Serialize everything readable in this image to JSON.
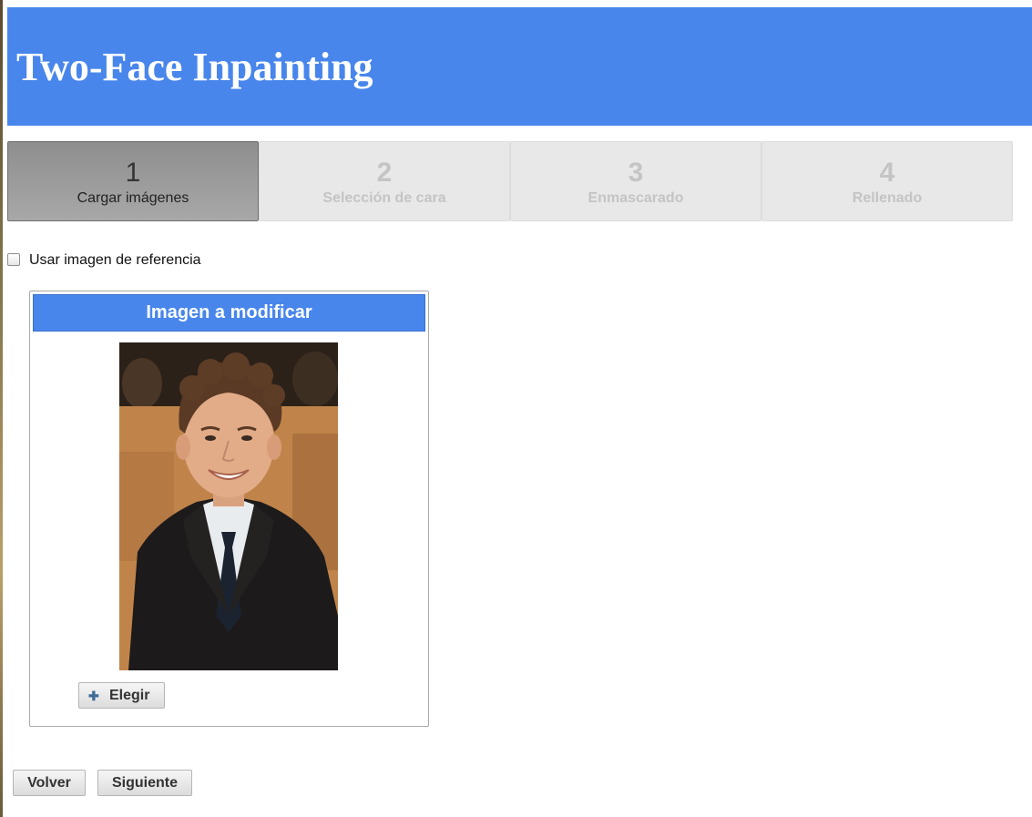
{
  "header": {
    "title": "Two-Face Inpainting"
  },
  "steps": [
    {
      "number": "1",
      "label": "Cargar imágenes",
      "active": true
    },
    {
      "number": "2",
      "label": "Selección de cara",
      "active": false
    },
    {
      "number": "3",
      "label": "Enmascarado",
      "active": false
    },
    {
      "number": "4",
      "label": "Rellenado",
      "active": false
    }
  ],
  "reference": {
    "label": "Usar imagen de referencia",
    "checked": false
  },
  "panel": {
    "title": "Imagen a modificar",
    "photo_icon": "person-portrait-photo",
    "choose_icon": "plus-icon",
    "choose_label": "Elegir"
  },
  "nav": {
    "back_label": "Volver",
    "next_label": "Siguiente"
  },
  "colors": {
    "accent": "#4886ec",
    "active_step": "#9a9a9a",
    "inactive_step": "#e8e8e8"
  }
}
